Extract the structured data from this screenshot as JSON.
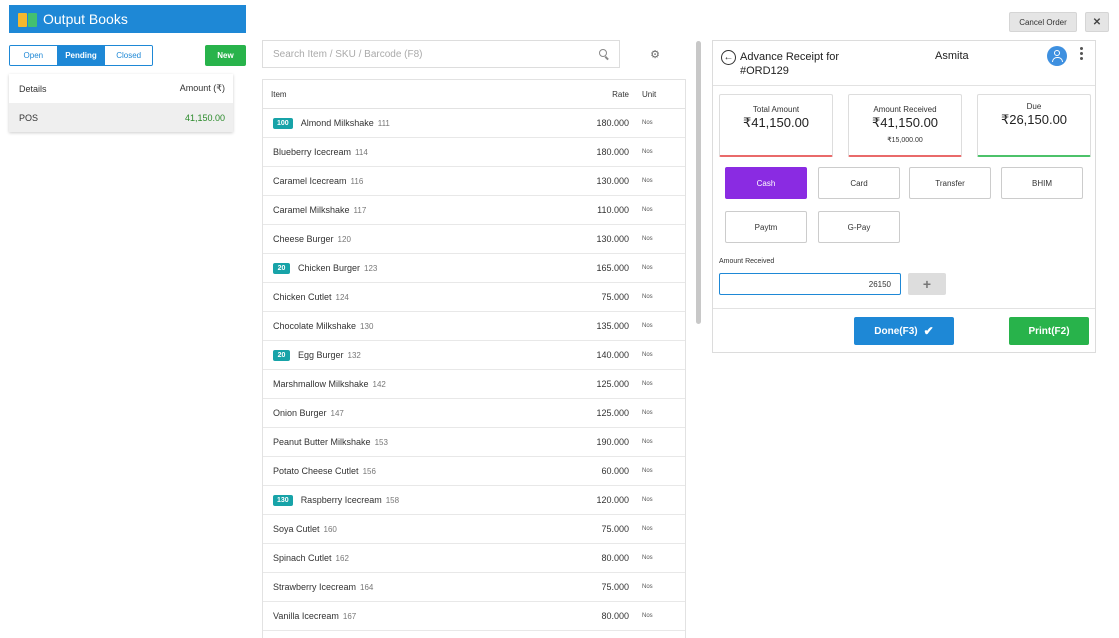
{
  "brand": {
    "title": "Output Books"
  },
  "status_tabs": [
    {
      "label": "Open",
      "active": false
    },
    {
      "label": "Pending",
      "active": true
    },
    {
      "label": "Closed",
      "active": false
    }
  ],
  "new_button": "New",
  "left_table": {
    "headers": [
      "Details",
      "Amount (₹)"
    ],
    "rows": [
      {
        "details": "POS",
        "amount": "41,150.00"
      }
    ]
  },
  "search": {
    "placeholder": "Search Item / SKU / Barcode (F8)"
  },
  "items_table": {
    "headers": {
      "item": "Item",
      "rate": "Rate",
      "unit": "Unit"
    },
    "rows": [
      {
        "qty": "100",
        "name": "Almond Milkshake",
        "code": "111",
        "rate": "180.000",
        "unit": "Nos"
      },
      {
        "qty": "",
        "name": "Blueberry Icecream",
        "code": "114",
        "rate": "180.000",
        "unit": "Nos"
      },
      {
        "qty": "",
        "name": "Caramel Icecream",
        "code": "116",
        "rate": "130.000",
        "unit": "Nos"
      },
      {
        "qty": "",
        "name": "Caramel Milkshake",
        "code": "117",
        "rate": "110.000",
        "unit": "Nos"
      },
      {
        "qty": "",
        "name": "Cheese Burger",
        "code": "120",
        "rate": "130.000",
        "unit": "Nos"
      },
      {
        "qty": "20",
        "name": "Chicken Burger",
        "code": "123",
        "rate": "165.000",
        "unit": "Nos"
      },
      {
        "qty": "",
        "name": "Chicken Cutlet",
        "code": "124",
        "rate": "75.000",
        "unit": "Nos"
      },
      {
        "qty": "",
        "name": "Chocolate Milkshake",
        "code": "130",
        "rate": "135.000",
        "unit": "Nos"
      },
      {
        "qty": "20",
        "name": "Egg Burger",
        "code": "132",
        "rate": "140.000",
        "unit": "Nos"
      },
      {
        "qty": "",
        "name": "Marshmallow Milkshake",
        "code": "142",
        "rate": "125.000",
        "unit": "Nos"
      },
      {
        "qty": "",
        "name": "Onion Burger",
        "code": "147",
        "rate": "125.000",
        "unit": "Nos"
      },
      {
        "qty": "",
        "name": "Peanut Butter Milkshake",
        "code": "153",
        "rate": "190.000",
        "unit": "Nos"
      },
      {
        "qty": "",
        "name": "Potato Cheese Cutlet",
        "code": "156",
        "rate": "60.000",
        "unit": "Nos"
      },
      {
        "qty": "130",
        "name": "Raspberry Icecream",
        "code": "158",
        "rate": "120.000",
        "unit": "Nos"
      },
      {
        "qty": "",
        "name": "Soya Cutlet",
        "code": "160",
        "rate": "75.000",
        "unit": "Nos"
      },
      {
        "qty": "",
        "name": "Spinach Cutlet",
        "code": "162",
        "rate": "80.000",
        "unit": "Nos"
      },
      {
        "qty": "",
        "name": "Strawberry Icecream",
        "code": "164",
        "rate": "75.000",
        "unit": "Nos"
      },
      {
        "qty": "",
        "name": "Vanilla Icecream",
        "code": "167",
        "rate": "80.000",
        "unit": "Nos"
      }
    ]
  },
  "top_actions": {
    "cancel_order": "Cancel Order",
    "close": "✕"
  },
  "receipt": {
    "title_line1": "Advance Receipt for",
    "title_line2": "#ORD129",
    "customer": "Asmita",
    "cards": {
      "total": {
        "label": "Total Amount",
        "value": "₹41,150.00"
      },
      "received": {
        "label": "Amount Received",
        "value": "₹41,150.00",
        "sub": "₹15,000.00"
      },
      "due": {
        "label": "Due",
        "value": "₹26,150.00"
      }
    },
    "payment_methods": [
      "Cash",
      "Card",
      "Transfer",
      "BHIM",
      "Paytm",
      "G-Pay"
    ],
    "active_method": "Cash",
    "amount_label": "Amount Received",
    "amount_value": "26150",
    "plus": "+",
    "done_label": "Done(F3)",
    "print_label": "Print(F2)"
  },
  "colors": {
    "primary": "#1e88d6",
    "success": "#28b34b",
    "active_method": "#8a2be2",
    "qty_badge": "#17a3a8",
    "due_border": "#4cc26a",
    "paid_border": "#e96a6a"
  },
  "icons": {
    "brand": "books-icon",
    "search": "search-icon",
    "settings": "gear-icon",
    "back": "back-arrow-icon",
    "user": "user-icon",
    "menu": "kebab-menu-icon",
    "done": "check-icon"
  }
}
